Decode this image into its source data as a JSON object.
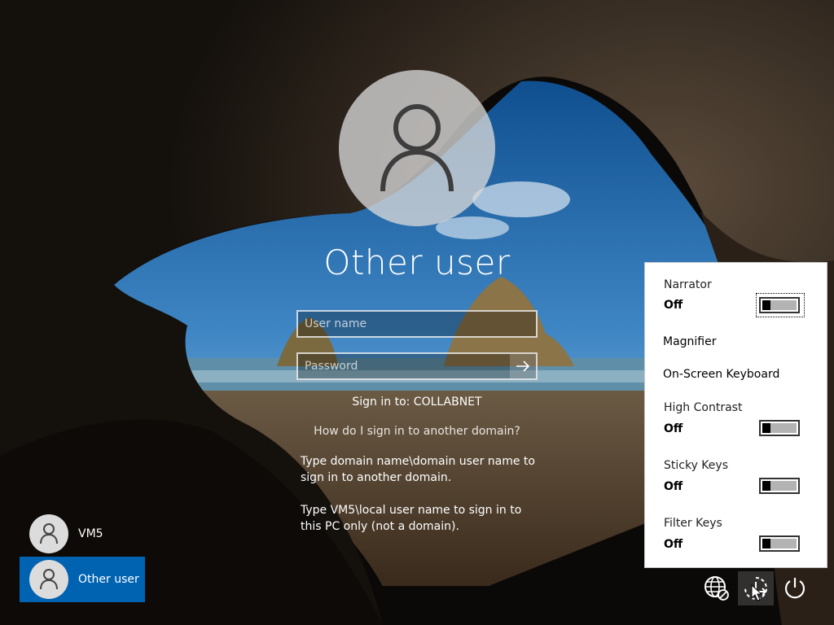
{
  "login": {
    "title": "Other user",
    "username_placeholder": "User name",
    "password_placeholder": "Password",
    "sign_in_to": "Sign in to: COLLABNET",
    "domain_link": "How do I sign in to another domain?",
    "help_line_1": "Type domain name\\domain user name to sign in to another domain.",
    "help_line_2": "Type VM5\\local user name to sign in to this PC only (not a domain)."
  },
  "users": [
    {
      "name": "VM5",
      "selected": false
    },
    {
      "name": "Other user",
      "selected": true
    }
  ],
  "ease_of_access": {
    "items": [
      {
        "label": "Narrator",
        "state": "Off",
        "toggle": "off"
      },
      {
        "label": "Magnifier"
      },
      {
        "label": "On-Screen Keyboard"
      },
      {
        "label": "High Contrast",
        "state": "Off",
        "toggle": "off"
      },
      {
        "label": "Sticky Keys",
        "state": "Off",
        "toggle": "off"
      },
      {
        "label": "Filter Keys",
        "state": "Off",
        "toggle": "off"
      }
    ]
  },
  "icons": {
    "network": "globe-network-icon",
    "ease_of_access": "ease-of-access-icon",
    "power": "power-icon",
    "submit": "arrow-right-icon",
    "user": "user-silhouette-icon"
  },
  "colors": {
    "selected_tile": "#0063b1",
    "flyout_bg": "#ffffff",
    "toggle_track": "#b3b3b3"
  }
}
